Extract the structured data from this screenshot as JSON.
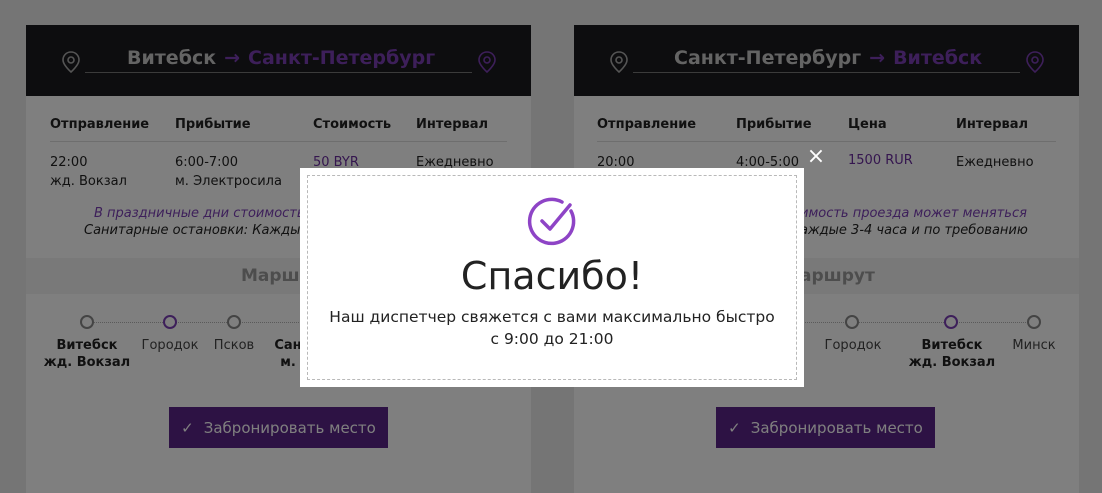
{
  "cards": [
    {
      "route": {
        "from": "Витебск",
        "arrow": "→",
        "to": "Санкт-Петербург"
      },
      "headers": [
        "Отправление",
        "Прибытие",
        "Стоимость",
        "Интервал"
      ],
      "departure": {
        "time": "22:00",
        "place": "жд. Вокзал"
      },
      "arrival": {
        "time": "6:00-7:00",
        "place": "м. Электросила"
      },
      "price": "50 BYR",
      "interval": "Ежедневно",
      "note_purple": "В праздничные дни стоимость",
      "note_dark": "Санитарные остановки: Каждые",
      "map_label": "Маршр",
      "stops": [
        {
          "line1": "Витебск",
          "line2": "жд. Вокзал",
          "bold": true
        },
        {
          "line1": "Городок",
          "line2": "",
          "bold": false
        },
        {
          "line1": "Псков",
          "line2": "",
          "bold": false
        },
        {
          "line1": "Сан",
          "line2": "м.",
          "bold": true
        }
      ],
      "book_label": "Забронировать место"
    },
    {
      "route": {
        "from": "Санкт-Петербург",
        "arrow": "→",
        "to": "Витебск"
      },
      "headers": [
        "Отправление",
        "Прибытие",
        "Цена",
        "Интервал"
      ],
      "departure": {
        "time": "20:00",
        "place": ""
      },
      "arrival": {
        "time": "4:00-5:00",
        "place": ""
      },
      "price": "1500 RUR",
      "interval": "Ежедневно",
      "note_purple": "имость проезда может меняться",
      "note_dark": "аждые 3-4 часа и по требованию",
      "map_label": "аршрут",
      "stops": [
        {
          "line1": "Городок",
          "line2": "",
          "bold": false
        },
        {
          "line1": "Витебск",
          "line2": "жд. Вокзал",
          "bold": true
        },
        {
          "line1": "Минск",
          "line2": "",
          "bold": false
        }
      ],
      "book_label": "Забронировать место"
    }
  ],
  "modal": {
    "title": "Спасибо!",
    "line1": "Наш диспетчер свяжется с вами максимально быстро",
    "line2": "с 9:00 до 21:00",
    "close_symbol": "×",
    "icon": "check-circle-icon"
  },
  "icons": {
    "pin": "map-pin-icon",
    "check": "✓"
  },
  "colors": {
    "accent": "#7b3fb5",
    "button": "#5a2588",
    "header_bg": "#1b1a1e",
    "overlay": "rgba(0,0,0,0.5)"
  }
}
